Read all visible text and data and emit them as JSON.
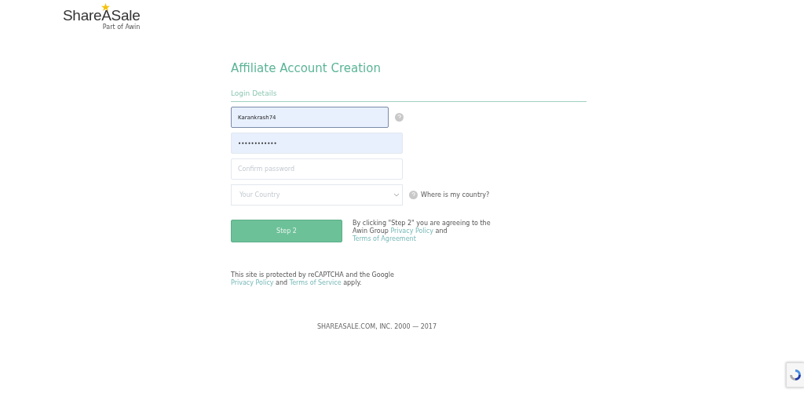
{
  "logo": {
    "name": "ShareASale",
    "tagline": "Part of Awin"
  },
  "title": "Affiliate Account Creation",
  "section": "Login Details",
  "fields": [
    {
      "kind": "text",
      "value": "Karankrash74",
      "focused": true,
      "help": true
    },
    {
      "kind": "password",
      "value": "••••••••••••",
      "autofilled": true
    },
    {
      "kind": "password",
      "placeholder": "Confirm password"
    },
    {
      "kind": "select",
      "placeholder": "Your Country",
      "help_link": "Where is my country?"
    }
  ],
  "submit": "Step 2",
  "agreement": [
    {
      "text": "By clicking \"Step 2\" you are agreeing to the Awin Group ",
      "link": false
    },
    {
      "text": "Privacy Policy",
      "link": true
    },
    {
      "text": " and ",
      "link": false
    },
    {
      "text": "Terms of Agreement",
      "link": true
    }
  ],
  "recaptcha_note": [
    {
      "text": "This site is protected by reCAPTCHA and the Google ",
      "link": false
    },
    {
      "text": "Privacy Policy",
      "link": true
    },
    {
      "text": " and ",
      "link": false
    },
    {
      "text": "Terms of Service",
      "link": true
    },
    {
      "text": " apply.",
      "link": false
    }
  ],
  "footer": "SHAREASALE.COM, INC. 2000 — 2017"
}
